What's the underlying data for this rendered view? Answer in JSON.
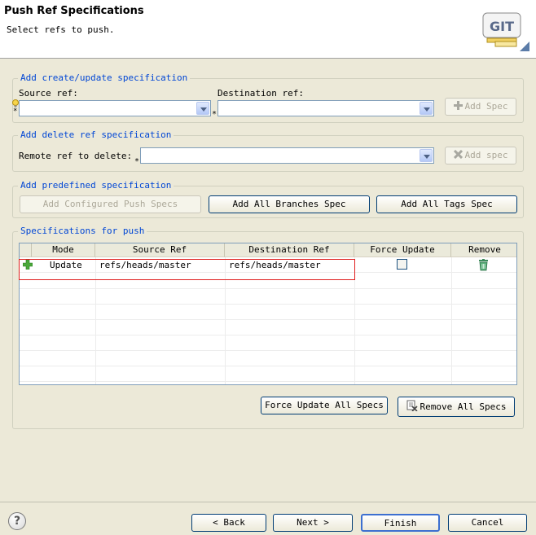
{
  "header": {
    "title": "Push Ref Specifications",
    "description": "Select refs to push.",
    "logo_text": "GIT"
  },
  "create_update": {
    "group_title": "Add create/update specification",
    "source_label": "Source ref:",
    "source_value": "",
    "destination_label": "Destination ref:",
    "destination_value": "",
    "add_button": "Add Spec"
  },
  "delete_spec": {
    "group_title": "Add delete ref specification",
    "remote_label": "Remote ref to delete:",
    "remote_value": "",
    "add_button": "Add spec"
  },
  "predefined": {
    "group_title": "Add predefined specification",
    "configured_button": "Add Configured Push Specs",
    "branches_button": "Add All Branches Spec",
    "tags_button": "Add All Tags Spec"
  },
  "specs": {
    "group_title": "Specifications for push",
    "columns": [
      "Mode",
      "Source Ref",
      "Destination Ref",
      "Force Update",
      "Remove"
    ],
    "rows": [
      {
        "mode": "Update",
        "source": "refs/heads/master",
        "destination": "refs/heads/master",
        "force_update": false
      }
    ],
    "force_all_button": "Force Update All Specs",
    "remove_all_button": "Remove All Specs"
  },
  "footer": {
    "help_icon": "?",
    "back": "< Back",
    "next": "Next >",
    "finish": "Finish",
    "cancel": "Cancel"
  },
  "colors": {
    "group_title": "#0046d5",
    "highlight": "#e02020",
    "add_icon": "#4aa83a"
  }
}
